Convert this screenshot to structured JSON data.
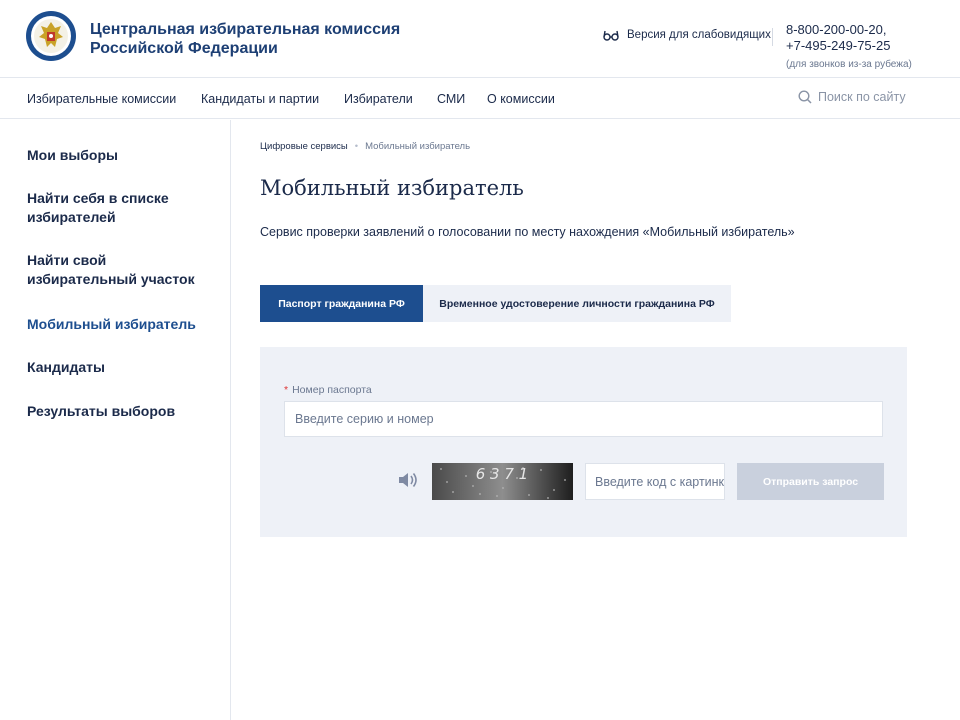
{
  "header": {
    "org_name_line1": "Центральная избирательная комиссия",
    "org_name_line2": "Российской Федерации",
    "low_vision_label": "Версия для слабовидящих",
    "phone1": "8-800-200-00-20,",
    "phone2": "+7-495-249-75-25",
    "phone_note": "(для звонков из-за рубежа)"
  },
  "nav": {
    "items": [
      "Избирательные комиссии",
      "Кандидаты и партии",
      "Избиратели",
      "СМИ",
      "О комиссии"
    ],
    "search_placeholder": "Поиск по сайту"
  },
  "sidebar": {
    "items": [
      {
        "label": "Мои выборы",
        "active": false
      },
      {
        "label": "Найти себя в списке избирателей",
        "active": false
      },
      {
        "label": "Найти свой избирательный участок",
        "active": false
      },
      {
        "label": "Мобильный избиратель",
        "active": true
      },
      {
        "label": "Кандидаты",
        "active": false
      },
      {
        "label": "Результаты выборов",
        "active": false
      }
    ]
  },
  "breadcrumb": {
    "parent": "Цифровые сервисы",
    "current": "Мобильный избиратель"
  },
  "main": {
    "title": "Мобильный избиратель",
    "description": "Сервис проверки заявлений о голосовании по месту нахождения «Мобильный избиратель»",
    "tabs": [
      {
        "label": "Паспорт гражданина РФ",
        "active": true
      },
      {
        "label": "Временное удостоверение личности гражданина РФ",
        "active": false
      }
    ]
  },
  "form": {
    "required_mark": "*",
    "passport_label": "Номер паспорта",
    "passport_placeholder": "Введите серию и номер",
    "passport_value": "",
    "captcha_code": "6 3 7 1",
    "captcha_placeholder": "Введите код с картинки",
    "submit_label": "Отправить запрос"
  },
  "colors": {
    "brand_blue": "#1d4e8f",
    "panel_bg": "#eef1f7",
    "disabled_button": "#c9d0dd"
  }
}
